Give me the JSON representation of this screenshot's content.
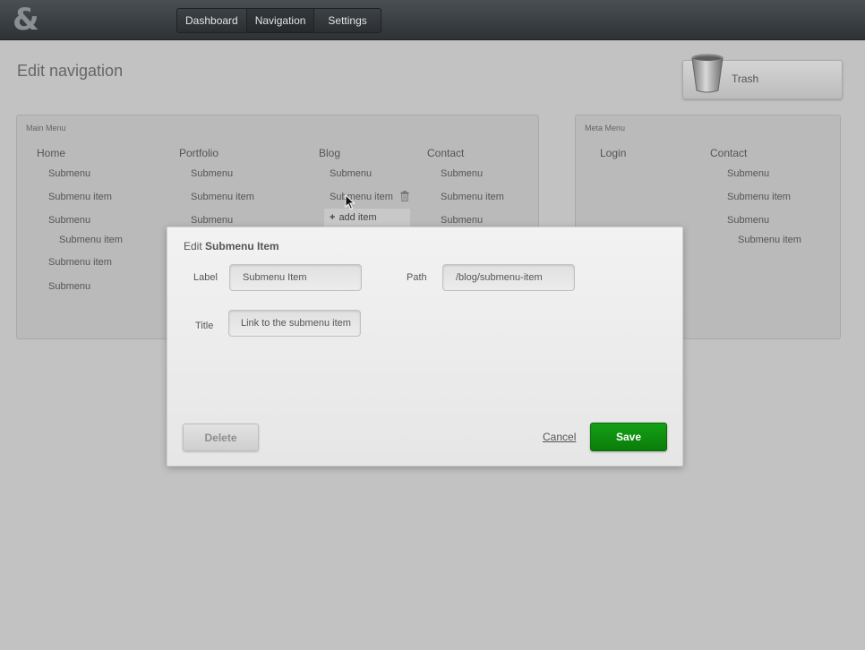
{
  "app": {
    "logo": "&"
  },
  "nav": {
    "tabs": [
      {
        "label": "Dashboard"
      },
      {
        "label": "Navigation"
      },
      {
        "label": "Settings"
      }
    ]
  },
  "page": {
    "title": "Edit navigation"
  },
  "trash": {
    "label": "Trash"
  },
  "main_menu": {
    "title": "Main Menu",
    "columns": [
      {
        "head": "Home",
        "items": [
          "Submenu",
          "Submenu item",
          "Submenu",
          "Submenu item",
          "Submenu item",
          "Submenu"
        ]
      },
      {
        "head": "Portfolio",
        "items": [
          "Submenu",
          "Submenu item",
          "Submenu"
        ]
      },
      {
        "head": "Blog",
        "items": [
          "Submenu",
          "Submenu item"
        ]
      },
      {
        "head": "Contact",
        "items": [
          "Submenu",
          "Submenu item",
          "Submenu"
        ]
      }
    ],
    "add_item": "add item"
  },
  "meta_menu": {
    "title": "Meta Menu",
    "columns": [
      {
        "head": "Login",
        "items": []
      },
      {
        "head": "Contact",
        "items": [
          "Submenu",
          "Submenu item",
          "Submenu",
          "Submenu item"
        ]
      }
    ]
  },
  "modal": {
    "title_prefix": "Edit",
    "title_bold": "Submenu Item",
    "label": {
      "label": "Label",
      "value": "Submenu Item"
    },
    "path": {
      "label": "Path",
      "value": "/blog/submenu-item"
    },
    "title_field": {
      "label": "Title",
      "value": "Link to the submenu item"
    },
    "delete_label": "Delete",
    "cancel_label": "Cancel",
    "save_label": "Save",
    "save_color": "#0f8f0f"
  }
}
